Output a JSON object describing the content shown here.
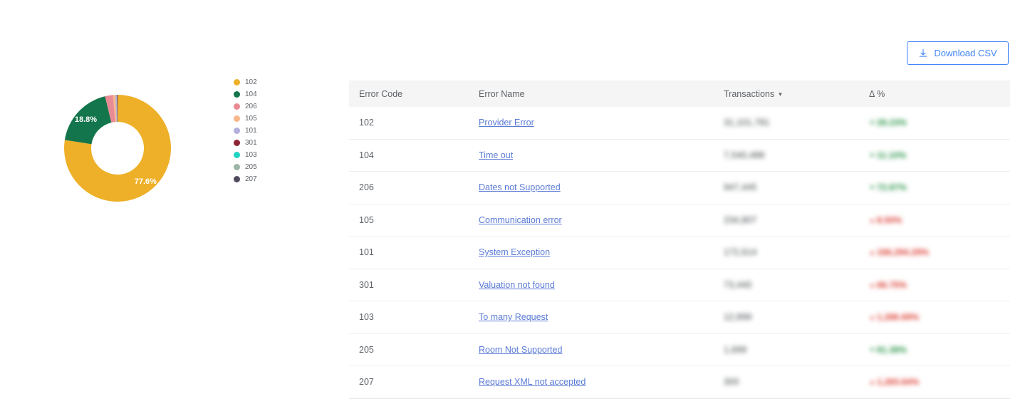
{
  "toolbar": {
    "download_csv_label": "Download CSV",
    "download_icon": "download-icon"
  },
  "chart_data": {
    "type": "pie",
    "variant": "donut",
    "title": "",
    "legend_position": "right",
    "categories": [
      "102",
      "104",
      "206",
      "105",
      "101",
      "301",
      "103",
      "205",
      "207"
    ],
    "values": [
      77.6,
      18.8,
      2.4,
      0.7,
      0.44,
      0.19,
      0.03,
      0.004,
      0.001
    ],
    "value_unit": "%",
    "visible_labels": [
      {
        "category": "102",
        "text": "77.6%"
      },
      {
        "category": "104",
        "text": "18.8%"
      }
    ],
    "colors": {
      "102": "#eeb028",
      "104": "#13754b",
      "206": "#e88b94",
      "105": "#f9b68a",
      "101": "#b3b0de",
      "301": "#8e2433",
      "103": "#20d4c2",
      "205": "#9db5a4",
      "207": "#514b5e"
    },
    "legend": [
      {
        "label": "102",
        "color": "#eeb028"
      },
      {
        "label": "104",
        "color": "#13754b"
      },
      {
        "label": "206",
        "color": "#e88b94"
      },
      {
        "label": "105",
        "color": "#f9b68a"
      },
      {
        "label": "101",
        "color": "#b3b0de"
      },
      {
        "label": "301",
        "color": "#8e2433"
      },
      {
        "label": "103",
        "color": "#20d4c2"
      },
      {
        "label": "205",
        "color": "#9db5a4"
      },
      {
        "label": "207",
        "color": "#514b5e"
      }
    ]
  },
  "table": {
    "sort_column": "Transactions",
    "sort_direction": "desc",
    "columns": [
      {
        "key": "error_code",
        "label": "Error Code",
        "sortable": true,
        "sorted": false
      },
      {
        "key": "error_name",
        "label": "Error Name",
        "sortable": true,
        "sorted": false
      },
      {
        "key": "transactions",
        "label": "Transactions",
        "sortable": true,
        "sorted": true,
        "caret": "▾"
      },
      {
        "key": "delta_pct",
        "label": "Δ %",
        "sortable": true,
        "sorted": false
      }
    ],
    "rows": [
      {
        "error_code": "102",
        "error_name": "Provider Error",
        "transactions": "31,101,781",
        "transactions_redacted": true,
        "delta_pct": "28.23%",
        "delta_redacted": true,
        "delta_direction": "down",
        "delta_arrow": "▼"
      },
      {
        "error_code": "104",
        "error_name": "Time out",
        "transactions": "7,540,488",
        "transactions_redacted": true,
        "delta_pct": "11.10%",
        "delta_redacted": true,
        "delta_direction": "down",
        "delta_arrow": "▼"
      },
      {
        "error_code": "206",
        "error_name": "Dates not Supported",
        "transactions": "947,445",
        "transactions_redacted": true,
        "delta_pct": "72.87%",
        "delta_redacted": true,
        "delta_direction": "down",
        "delta_arrow": "▼"
      },
      {
        "error_code": "105",
        "error_name": "Communication error",
        "transactions": "234,807",
        "transactions_redacted": true,
        "delta_pct": "8.50%",
        "delta_redacted": true,
        "delta_direction": "up",
        "delta_arrow": "▲"
      },
      {
        "error_code": "101",
        "error_name": "System Exception",
        "transactions": "172,614",
        "transactions_redacted": true,
        "delta_pct": "166,294.29%",
        "delta_redacted": true,
        "delta_direction": "up",
        "delta_arrow": "▲"
      },
      {
        "error_code": "301",
        "error_name": "Valuation not found",
        "transactions": "73,440",
        "transactions_redacted": true,
        "delta_pct": "66.75%",
        "delta_redacted": true,
        "delta_direction": "up",
        "delta_arrow": "▲"
      },
      {
        "error_code": "103",
        "error_name": "To many Request",
        "transactions": "12,899",
        "transactions_redacted": true,
        "delta_pct": "1,286.69%",
        "delta_redacted": true,
        "delta_direction": "up",
        "delta_arrow": "▲"
      },
      {
        "error_code": "205",
        "error_name": "Room Not Supported",
        "transactions": "1,699",
        "transactions_redacted": true,
        "delta_pct": "81.38%",
        "delta_redacted": true,
        "delta_direction": "down",
        "delta_arrow": "▼"
      },
      {
        "error_code": "207",
        "error_name": "Request XML not accepted",
        "transactions": "300",
        "transactions_redacted": true,
        "delta_pct": "1,283.64%",
        "delta_redacted": true,
        "delta_direction": "up",
        "delta_arrow": "▲"
      }
    ]
  }
}
